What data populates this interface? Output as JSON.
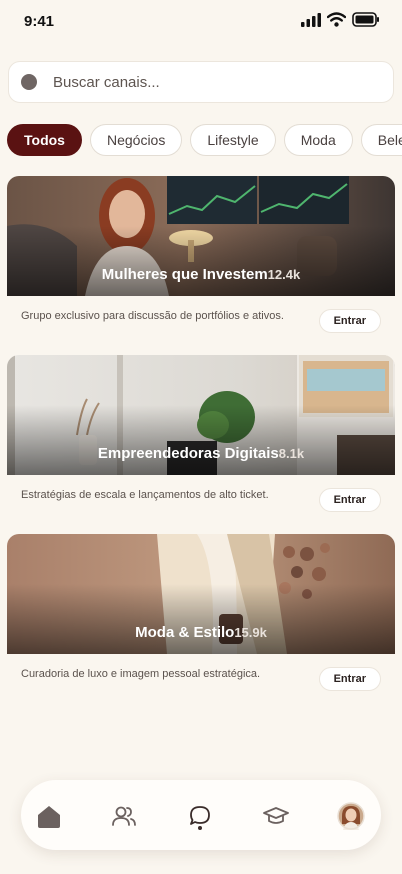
{
  "status_bar": {
    "time": "9:41"
  },
  "search": {
    "placeholder": "Buscar canais..."
  },
  "filters": [
    {
      "label": "Todos",
      "active": true
    },
    {
      "label": "Negócios",
      "active": false
    },
    {
      "label": "Lifestyle",
      "active": false
    },
    {
      "label": "Moda",
      "active": false
    },
    {
      "label": "Bele",
      "active": false
    }
  ],
  "channels": [
    {
      "title": "Mulheres que Investem",
      "members": "12.4k",
      "description": "Grupo exclusivo para discussão de portfólios e ativos.",
      "button": "Entrar"
    },
    {
      "title": "Empreendedoras Digitais",
      "members": "8.1k",
      "description": "Estratégias de escala e lançamentos de alto ticket.",
      "button": "Entrar"
    },
    {
      "title": "Moda & Estilo",
      "members": "15.9k",
      "description": "Curadoria de luxo e imagem pessoal estratégica.",
      "button": "Entrar"
    }
  ],
  "bottom_nav": {
    "items": [
      "home-icon",
      "community-icon",
      "chat-icon",
      "graduation-cap-icon",
      "profile-avatar"
    ],
    "active": "chat-icon"
  },
  "colors": {
    "accent": "#5a1212",
    "background": "#faf6ef"
  }
}
